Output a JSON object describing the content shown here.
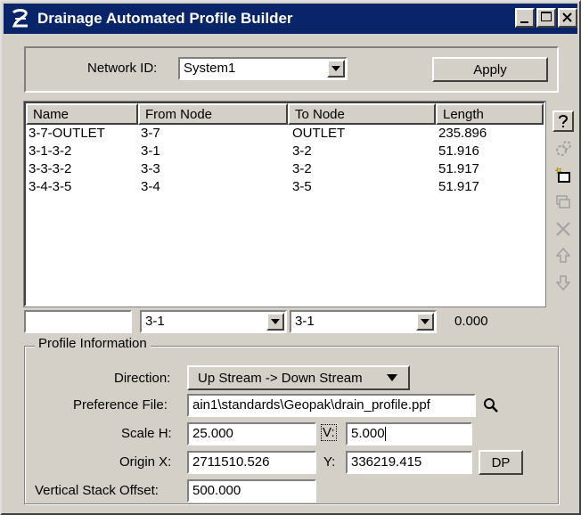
{
  "window": {
    "title": "Drainage Automated Profile Builder",
    "app_icon": "geopak-logo-icon",
    "buttons": [
      "minimize-icon",
      "maximize-icon",
      "close-icon"
    ]
  },
  "network": {
    "label": "Network ID:",
    "value": "System1",
    "apply_label": "Apply"
  },
  "table": {
    "headers": [
      "Name",
      "From Node",
      "To Node",
      "Length"
    ],
    "rows": [
      [
        "3-7-OUTLET",
        "3-7",
        "OUTLET",
        "235.896"
      ],
      [
        "3-1-3-2",
        "3-1",
        "3-2",
        "51.916"
      ],
      [
        "3-3-3-2",
        "3-3",
        "3-2",
        "51.917"
      ],
      [
        "3-4-3-5",
        "3-4",
        "3-5",
        "51.917"
      ]
    ]
  },
  "edit_row": {
    "name": "",
    "from": "3-1",
    "to": "3-1",
    "length": "0.000"
  },
  "toolbar_icons": [
    "help-icon",
    "gear-icon",
    "new-icon",
    "copy-icon",
    "delete-icon",
    "move-up-icon",
    "move-down-icon"
  ],
  "profile": {
    "group_title": "Profile Information",
    "direction_label": "Direction:",
    "direction_value": "Up Stream -> Down Stream",
    "preference_label": "Preference File:",
    "preference_value": "ain1\\standards\\Geopak\\drain_profile.ppf",
    "scale_h_label": "Scale H:",
    "scale_h_value": "25.000",
    "scale_v_label": "V:",
    "scale_v_value": "5.000",
    "origin_x_label": "Origin X:",
    "origin_x_value": "2711510.526",
    "origin_y_label": "Y:",
    "origin_y_value": "336219.415",
    "dp_label": "DP",
    "stack_label": "Vertical Stack Offset:",
    "stack_value": "500.000"
  }
}
